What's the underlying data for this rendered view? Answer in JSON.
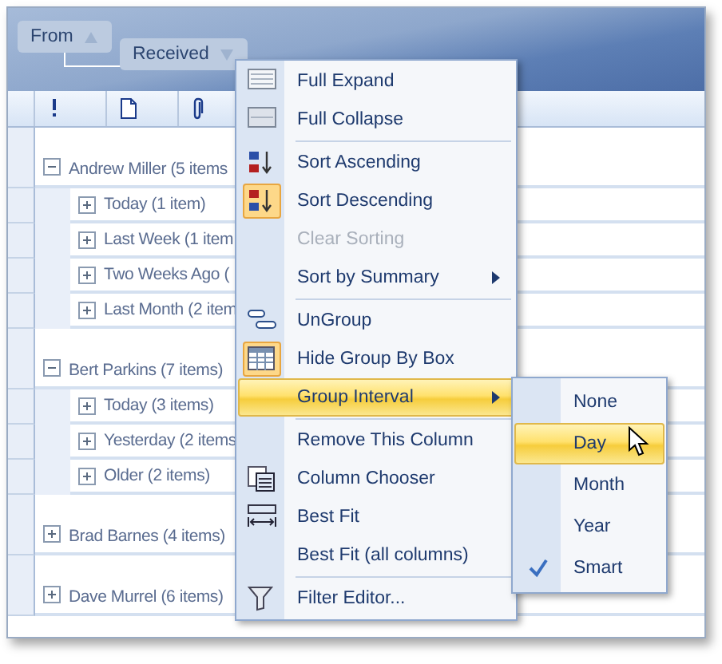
{
  "group_panel": {
    "fields": [
      {
        "label": "From",
        "ascending": true
      },
      {
        "label": "Received",
        "ascending": false
      }
    ]
  },
  "columns": [
    {
      "kind": "importance"
    },
    {
      "kind": "document"
    },
    {
      "kind": "attachment"
    }
  ],
  "groups": [
    {
      "label": "Andrew Miller (5 items",
      "expanded": true,
      "children": [
        {
          "label": "Today (1 item)",
          "expanded": false
        },
        {
          "label": "Last Week (1 item",
          "expanded": false
        },
        {
          "label": "Two Weeks Ago (",
          "expanded": false
        },
        {
          "label": "Last Month (2 item",
          "expanded": false
        }
      ]
    },
    {
      "label": "Bert Parkins (7 items)",
      "expanded": true,
      "children": [
        {
          "label": "Today (3 items)",
          "expanded": false
        },
        {
          "label": "Yesterday (2 items",
          "expanded": false
        },
        {
          "label": "Older (2 items)",
          "expanded": false
        }
      ]
    },
    {
      "label": "Brad Barnes (4 items)",
      "expanded": false
    },
    {
      "label": "Dave Murrel (6 items)",
      "expanded": false
    }
  ],
  "menu": [
    {
      "label": "Full Expand",
      "kind": "expand",
      "checked": false,
      "disabled": false,
      "selected": false,
      "submenu": false
    },
    {
      "label": "Full Collapse",
      "kind": "collapse",
      "checked": false,
      "disabled": false,
      "selected": false,
      "submenu": false
    },
    {
      "kind": "separator"
    },
    {
      "label": "Sort Ascending",
      "kind": "ascending",
      "checked": false,
      "disabled": false,
      "selected": false,
      "submenu": false
    },
    {
      "label": "Sort Descending",
      "kind": "descending",
      "checked": true,
      "disabled": false,
      "selected": false,
      "submenu": false
    },
    {
      "label": "Clear Sorting",
      "checked": false,
      "disabled": true,
      "selected": false,
      "submenu": false
    },
    {
      "label": "Sort by Summary",
      "checked": false,
      "disabled": false,
      "selected": false,
      "submenu": true
    },
    {
      "kind": "separator"
    },
    {
      "label": "UnGroup",
      "kind": "ungroup",
      "checked": false,
      "disabled": false,
      "selected": false,
      "submenu": false
    },
    {
      "label": "Hide Group By Box",
      "kind": "groupbox",
      "checked": true,
      "disabled": false,
      "selected": false,
      "submenu": false
    },
    {
      "label": "Group Interval",
      "checked": false,
      "disabled": false,
      "selected": true,
      "submenu": true
    },
    {
      "kind": "separator"
    },
    {
      "label": "Remove This Column",
      "checked": false,
      "disabled": false,
      "selected": false,
      "submenu": false
    },
    {
      "label": "Column Chooser",
      "kind": "chooser",
      "checked": false,
      "disabled": false,
      "selected": false,
      "submenu": false
    },
    {
      "label": "Best Fit",
      "kind": "bestfit",
      "checked": false,
      "disabled": false,
      "selected": false,
      "submenu": false
    },
    {
      "label": "Best Fit (all columns)",
      "checked": false,
      "disabled": false,
      "selected": false,
      "submenu": false
    },
    {
      "kind": "separator"
    },
    {
      "label": "Filter Editor...",
      "kind": "filter",
      "checked": false,
      "disabled": false,
      "selected": false,
      "submenu": false
    }
  ],
  "submenu": [
    {
      "label": "None",
      "selected": false,
      "checked": false
    },
    {
      "label": "Day",
      "selected": true,
      "checked": false
    },
    {
      "label": "Month",
      "selected": false,
      "checked": false
    },
    {
      "label": "Year",
      "selected": false,
      "checked": false
    },
    {
      "label": "Smart",
      "selected": false,
      "checked": true
    }
  ]
}
